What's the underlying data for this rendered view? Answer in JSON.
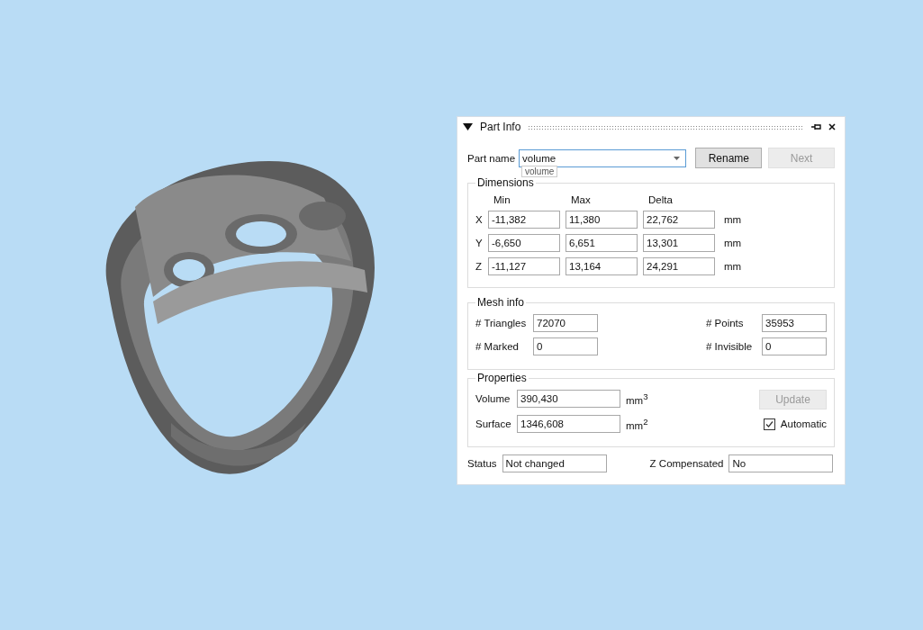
{
  "panel": {
    "title": "Part Info",
    "part_name": {
      "label": "Part name",
      "value": "volume",
      "tooltip": "volume"
    },
    "buttons": [
      {
        "label": "Rename",
        "disabled": false
      },
      {
        "label": "Next",
        "disabled": true
      }
    ],
    "dimensions": {
      "title": "Dimensions",
      "columns": [
        "Min",
        "Max",
        "Delta"
      ],
      "rows": [
        {
          "axis": "X",
          "values": [
            "-11,382",
            "11,380",
            "22,762"
          ],
          "unit": "mm"
        },
        {
          "axis": "Y",
          "values": [
            "-6,650",
            "6,651",
            "13,301"
          ],
          "unit": "mm"
        },
        {
          "axis": "Z",
          "values": [
            "-11,127",
            "13,164",
            "24,291"
          ],
          "unit": "mm"
        }
      ]
    },
    "mesh_info": {
      "title": "Mesh info",
      "fields": [
        {
          "label": "# Triangles",
          "value": "72070"
        },
        {
          "label": "# Points",
          "value": "35953"
        },
        {
          "label": "# Marked",
          "value": "0"
        },
        {
          "label": "# Invisible",
          "value": "0"
        }
      ]
    },
    "properties": {
      "title": "Properties",
      "fields": [
        {
          "label": "Volume",
          "value": "390,430",
          "unit": "mm$^{3}$"
        },
        {
          "label": "Surface",
          "value": "1346,608",
          "unit": "mm$^{2}$"
        }
      ],
      "update_button": {
        "label": "Update",
        "disabled": true
      },
      "automatic": {
        "label": "Automatic",
        "checked": true
      }
    },
    "status": {
      "label": "Status",
      "value": "Not changed"
    },
    "z_compensated": {
      "label": "Z Compensated",
      "value": "No"
    }
  }
}
